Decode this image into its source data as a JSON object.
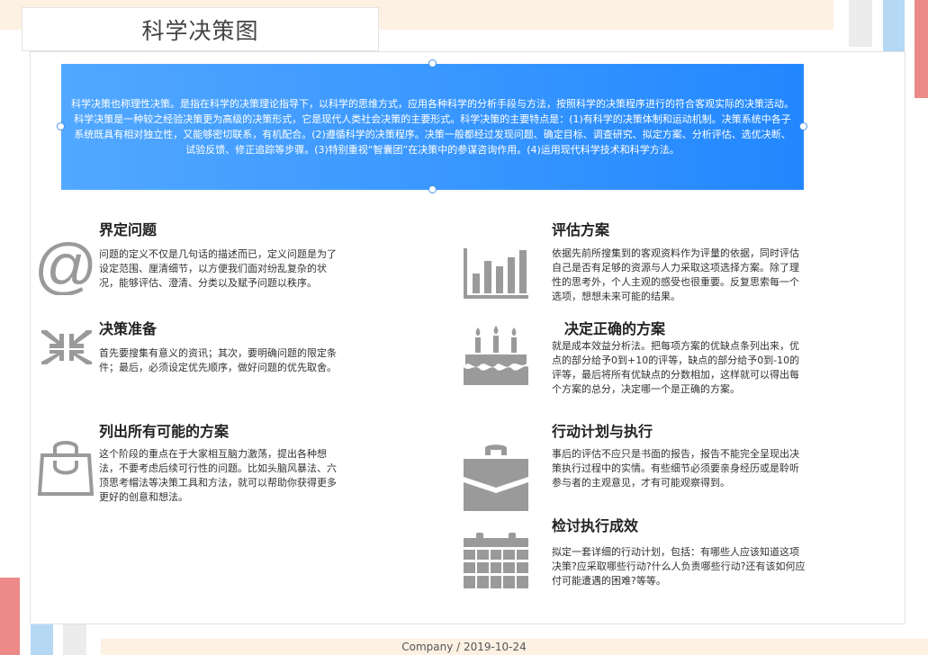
{
  "title": "科学决策图",
  "intro": "科学决策也称理性决策。是指在科学的决策理论指导下，以科学的思维方式，应用各种科学的分析手段与方法，按照科学的决策程序进行的符合客观实际的决策活动。科学决策是一种较之经验决策更为高级的决策形式，它是现代人类社会决策的主要形式。科学决策的主要特点是：(1)有科学的决策体制和运动机制。决策系统中各子系统既具有相对独立性，又能够密切联系，有机配合。(2)遵循科学的决策程序。决策一般都经过发现问题、确定目标、调查研究、拟定方案、分析评估、选优决断、试验反馈、修正追踪等步骤。(3)特别重视“智囊团”在决策中的参谋咨询作用。(4)运用现代科学技术和科学方法。",
  "steps": [
    {
      "title": "界定问题",
      "text": "问题的定义不仅是几句话的描述而已，定义问题是为了设定范围、厘清细节，以方便我们面对纷乱复杂的状况，能够评估、澄清、分类以及赋予问题以秩序。",
      "icon": "at-sign-icon"
    },
    {
      "title": "决策准备",
      "text": "首先要搜集有意义的资讯；其次，要明确问题的限定条件；最后，必须设定优先顺序，做好问题的优先取舍。",
      "icon": "compress-arrows-icon"
    },
    {
      "title": "列出所有可能的方案",
      "text": "这个阶段的重点在于大家相互脑力激荡，提出各种想法，不要考虑后续可行性的问题。比如头脑风暴法、六顶思考帽法等决策工具和方法，就可以帮助你获得更多更好的创意和想法。",
      "icon": "shopping-bag-icon"
    },
    {
      "title": "评估方案",
      "text": "依据先前所搜集到的客观资料作为评量的依据，同时评估自己是否有足够的资源与人力采取这项选择方案。除了理性的思考外，个人主观的感受也很重要。反复思索每一个选项，想想未来可能的结果。",
      "icon": "bar-chart-icon"
    },
    {
      "title": "决定正确的方案",
      "text": "就是成本效益分析法。把每项方案的优缺点条列出来，优点的部分给予0到+10的评等，缺点的部分给予0到-10的评等，最后将所有优缺点的分数相加，这样就可以得出每个方案的总分，决定哪一个是正确的方案。",
      "icon": "birthday-cake-icon"
    },
    {
      "title": "行动计划与执行",
      "text": "事后的评估不应只是书面的报告，报告不能完全呈现出决策执行过程中的实情。有些细节必须要亲身经历或是聆听参与者的主观意见，才有可能观察得到。",
      "icon": "briefcase-icon"
    },
    {
      "title": "检讨执行成效",
      "text": "拟定一套详细的行动计划，包括：有哪些人应该知道这项决策?应采取哪些行动?什么人负责哪些行动?还有该如何应付可能遭遇的困难?等等。",
      "icon": "calendar-icon"
    }
  ],
  "footer": "Company / 2019-10-24",
  "colors": {
    "intro_start": "#52a8ff",
    "intro_end": "#2287ff",
    "icon": "#9a9a9a",
    "accent_red": "#ec8989",
    "accent_blue": "#b5d8f5",
    "band": "#fdf1e4"
  }
}
